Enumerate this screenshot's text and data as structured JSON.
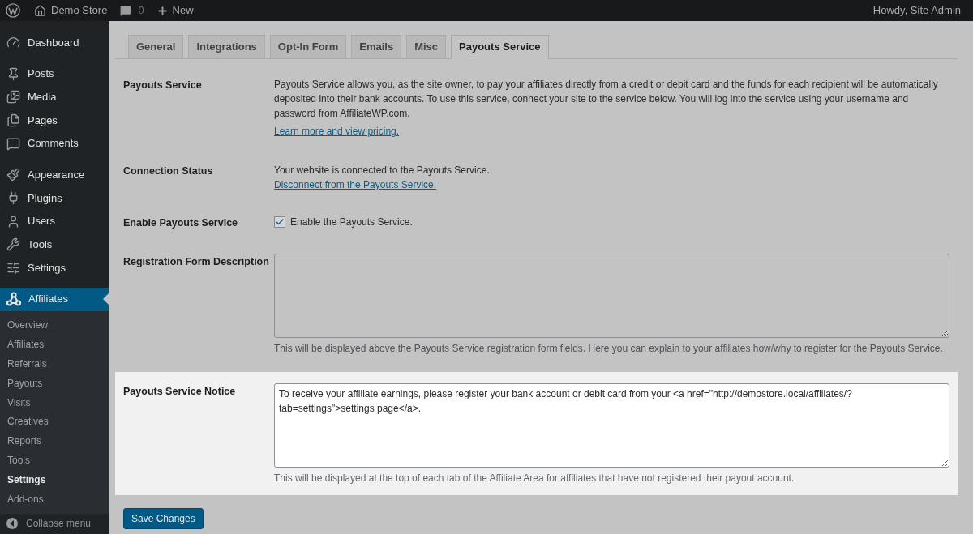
{
  "admin_bar": {
    "site_name": "Demo Store",
    "comments_count": "0",
    "new_label": "New",
    "greeting": "Howdy, Site Admin"
  },
  "sidebar": {
    "menu_groups": [
      [
        {
          "label": "Dashboard",
          "selected": false
        }
      ],
      [
        {
          "label": "Posts",
          "selected": false
        },
        {
          "label": "Media",
          "selected": false
        },
        {
          "label": "Pages",
          "selected": false
        },
        {
          "label": "Comments",
          "selected": false
        }
      ],
      [
        {
          "label": "Appearance",
          "selected": false
        },
        {
          "label": "Plugins",
          "selected": false
        },
        {
          "label": "Users",
          "selected": false
        },
        {
          "label": "Tools",
          "selected": false
        },
        {
          "label": "Settings",
          "selected": false
        }
      ],
      [
        {
          "label": "Affiliates",
          "selected": true,
          "children": [
            {
              "label": "Overview",
              "selected": false
            },
            {
              "label": "Affiliates",
              "selected": false
            },
            {
              "label": "Referrals",
              "selected": false
            },
            {
              "label": "Payouts",
              "selected": false
            },
            {
              "label": "Visits",
              "selected": false
            },
            {
              "label": "Creatives",
              "selected": false
            },
            {
              "label": "Reports",
              "selected": false
            },
            {
              "label": "Tools",
              "selected": false
            },
            {
              "label": "Settings",
              "selected": true
            },
            {
              "label": "Add-ons",
              "selected": false
            }
          ]
        }
      ]
    ],
    "collapse_label": "Collapse menu"
  },
  "tabs": [
    {
      "label": "General",
      "selected": false
    },
    {
      "label": "Integrations",
      "selected": false
    },
    {
      "label": "Opt-In Form",
      "selected": false
    },
    {
      "label": "Emails",
      "selected": false
    },
    {
      "label": "Misc",
      "selected": false
    },
    {
      "label": "Payouts Service",
      "selected": true
    }
  ],
  "settings": [
    {
      "kind": "info",
      "label": "Payouts Service",
      "text": "Payouts Service allows you, as the site owner, to pay your affiliates directly from a credit or debit card and the funds for each recipient will be automatically deposited into their bank accounts. To use this service, connect your site to the service below. You will log into the service using your username and password from AffiliateWP.com.",
      "link": "Learn more and view pricing.",
      "highlighted": false
    },
    {
      "kind": "status",
      "label": "Connection Status",
      "text": "Your website is connected to the Payouts Service.",
      "link": "Disconnect from the Payouts Service.",
      "highlighted": false
    },
    {
      "kind": "checkbox",
      "label": "Enable Payouts Service",
      "checked": true,
      "text": "Enable the Payouts Service.",
      "highlighted": false
    },
    {
      "kind": "textarea",
      "label": "Registration Form Description",
      "description": "This will be displayed above the Payouts Service registration form fields. Here you can explain to your affiliates how/why to register for the Payouts Service.",
      "highlighted": false
    },
    {
      "kind": "textarea",
      "label": "Payouts Service Notice",
      "value": "To receive your affiliate earnings, please register your bank account or debit card from your <a href=\"http://demostore.local/affiliates/?tab=settings\">settings page</a>.",
      "description": "This will be displayed at the top of each tab of the Affiliate Area for affiliates that have not registered their payout account.",
      "highlighted": true
    }
  ],
  "save_button": "Save Changes"
}
